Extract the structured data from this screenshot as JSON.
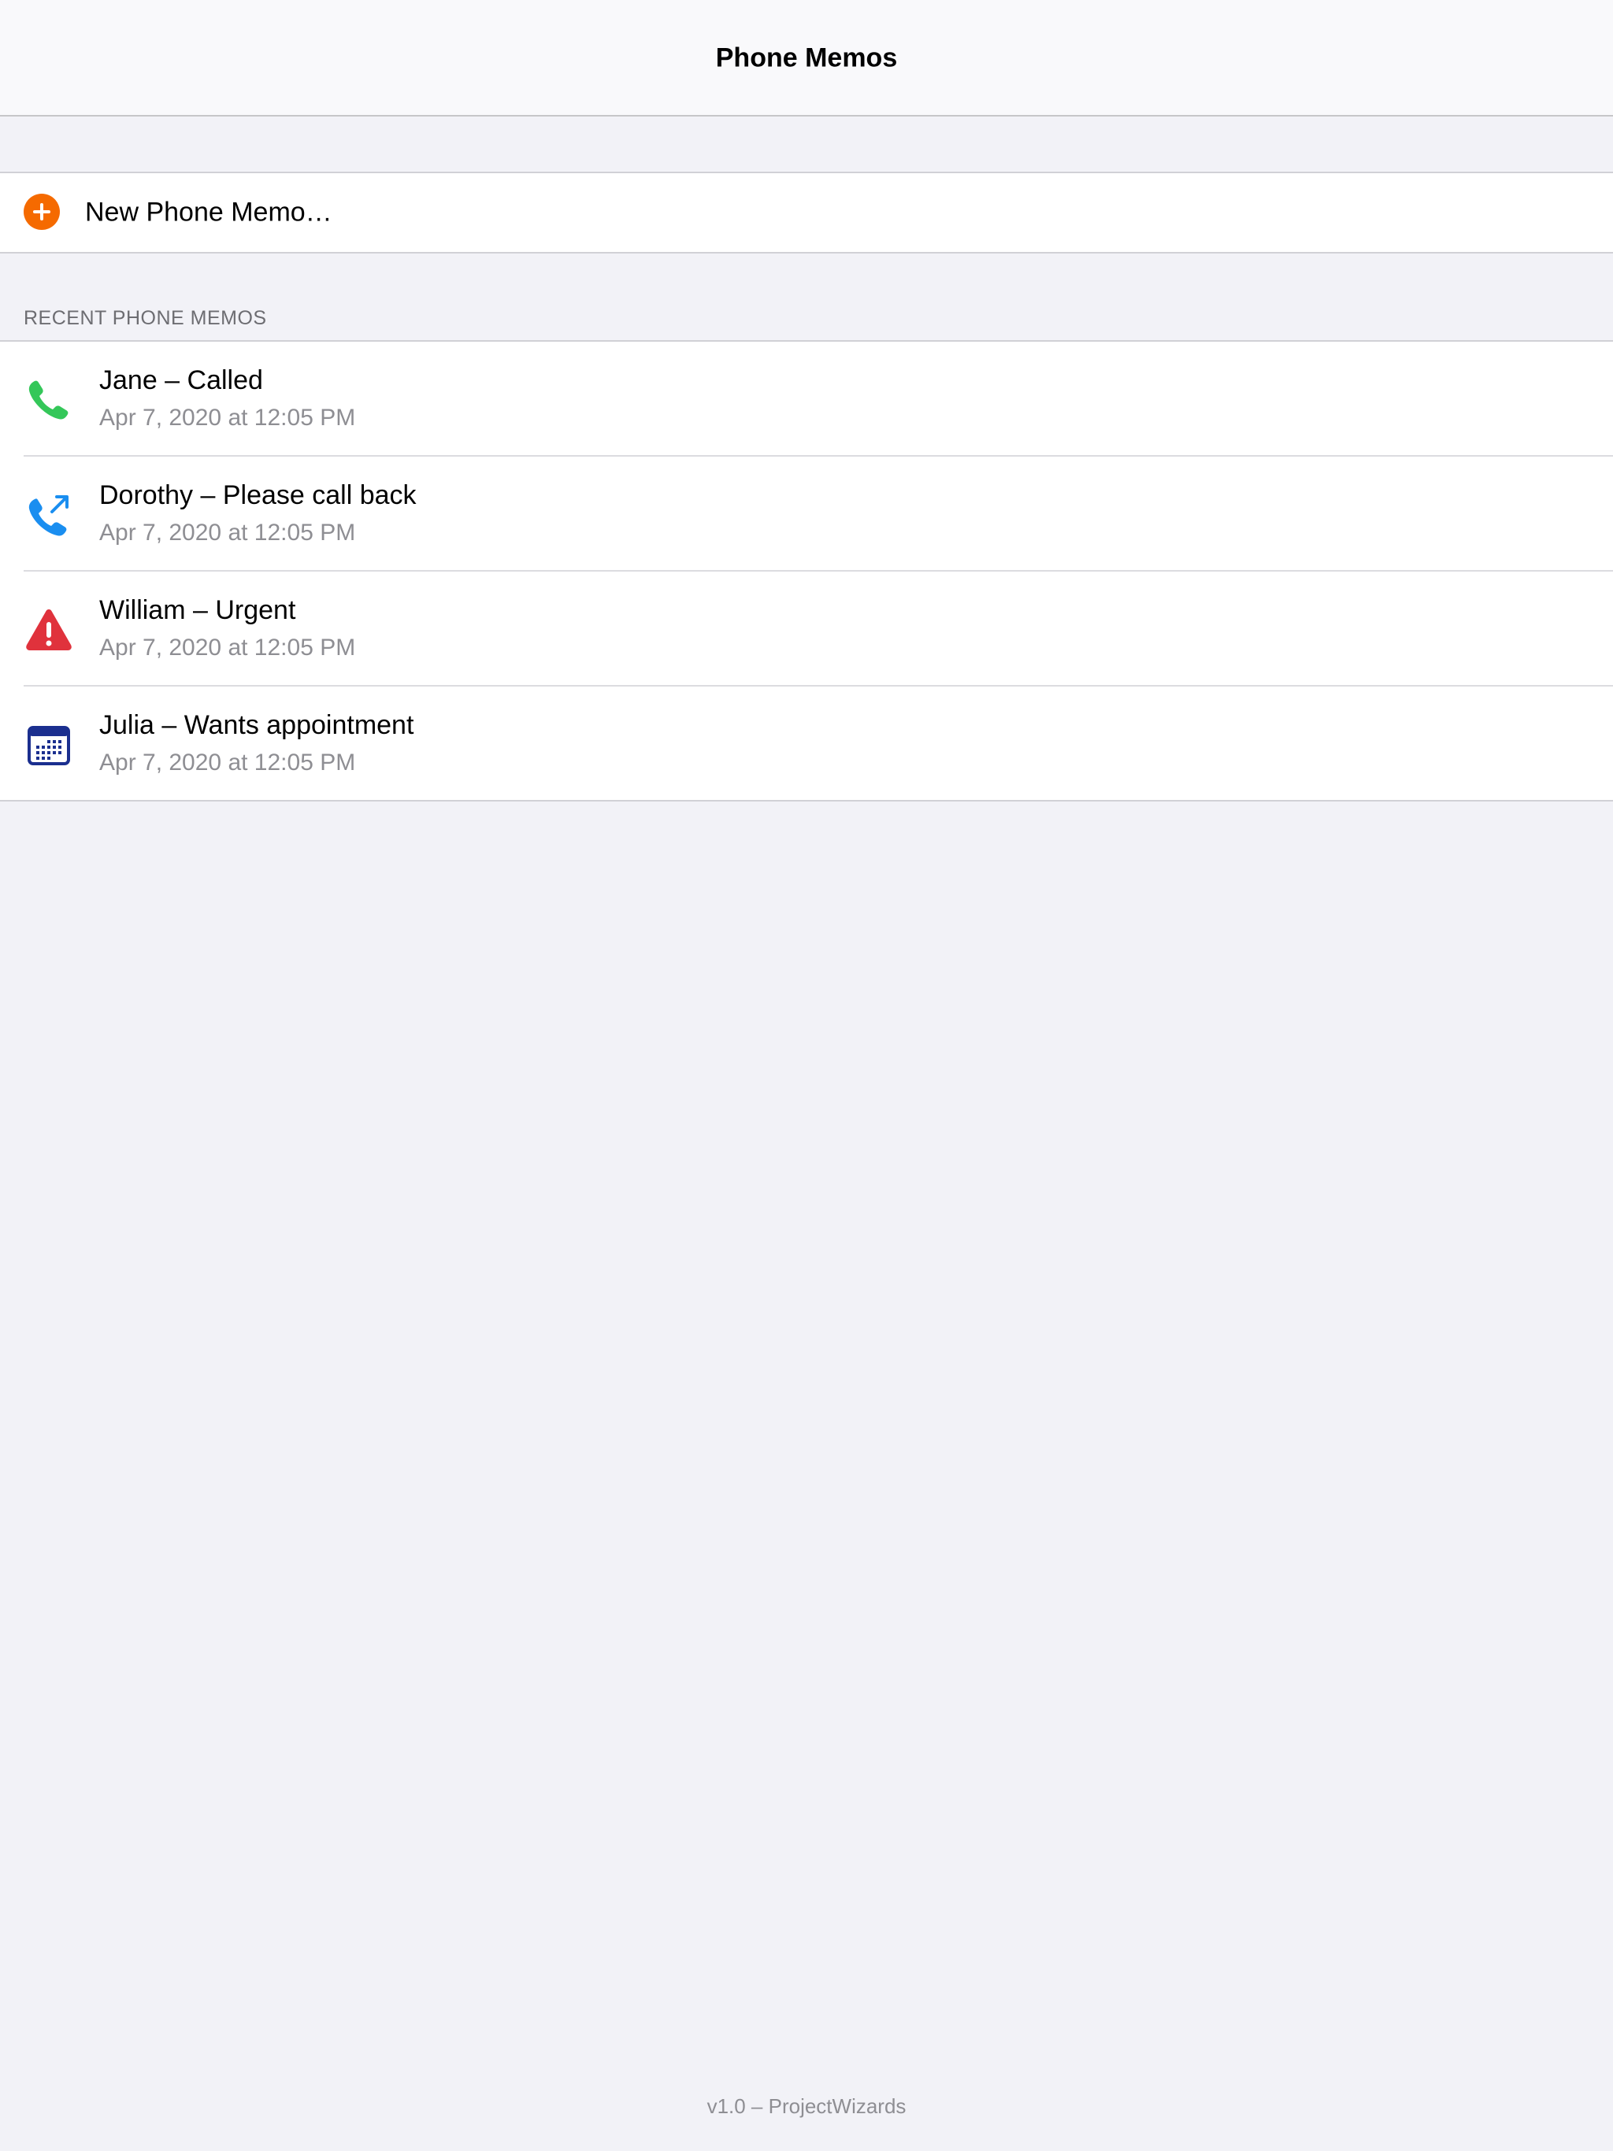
{
  "header": {
    "title": "Phone Memos"
  },
  "new_memo": {
    "label": "New Phone Memo…",
    "icon": "plus-circle-icon",
    "color": "#f56a00"
  },
  "recent": {
    "section_title": "RECENT PHONE MEMOS",
    "items": [
      {
        "title": "Jane – Called",
        "date": "Apr 7, 2020 at 12:05 PM",
        "icon": "phone-icon",
        "color": "#34c759"
      },
      {
        "title": "Dorothy – Please call back",
        "date": "Apr 7, 2020 at 12:05 PM",
        "icon": "phone-callback-icon",
        "color": "#1a8ef0"
      },
      {
        "title": "William – Urgent",
        "date": "Apr 7, 2020 at 12:05 PM",
        "icon": "warning-icon",
        "color": "#e0323c"
      },
      {
        "title": "Julia – Wants appointment",
        "date": "Apr 7, 2020 at 12:05 PM",
        "icon": "calendar-icon",
        "color": "#1b2f8f"
      }
    ]
  },
  "footer": {
    "text": "v1.0 – ProjectWizards"
  }
}
